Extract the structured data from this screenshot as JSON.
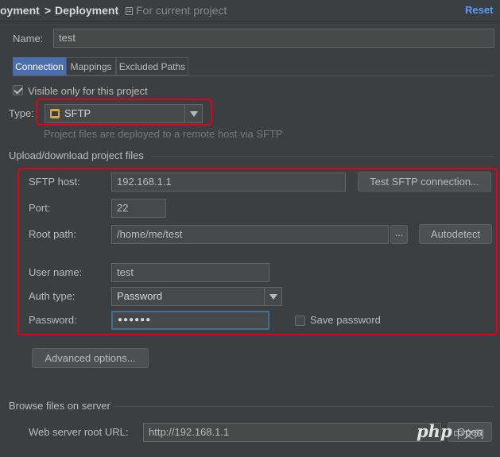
{
  "header": {
    "breadcrumb_first": "oyment",
    "breadcrumb_separator": ">",
    "breadcrumb_second": "Deployment",
    "scope_text": "For current project",
    "reset_label": "Reset"
  },
  "name": {
    "label": "Name:",
    "value": "test"
  },
  "tabs": [
    {
      "label": "Connection",
      "active": true
    },
    {
      "label": "Mappings",
      "active": false
    },
    {
      "label": "Excluded Paths",
      "active": false
    }
  ],
  "visible_only": {
    "label": "Visible only for this project",
    "checked": true
  },
  "type": {
    "label": "Type:",
    "value": "SFTP",
    "description": "Project files are deployed to a remote host via SFTP"
  },
  "upload_section": {
    "title": "Upload/download project files",
    "sftp_host": {
      "label": "SFTP host:",
      "value": "192.168.1.1"
    },
    "test_button": "Test SFTP connection...",
    "port": {
      "label": "Port:",
      "value": "22"
    },
    "root_path": {
      "label": "Root path:",
      "value": "/home/me/test",
      "browse": "..."
    },
    "autodetect_button": "Autodetect",
    "user_name": {
      "label": "User name:",
      "value": "test"
    },
    "auth_type": {
      "label": "Auth type:",
      "value": "Password"
    },
    "password": {
      "label": "Password:",
      "value": "●●●●●●"
    },
    "save_password": {
      "label": "Save password",
      "checked": false
    }
  },
  "advanced_button": "Advanced options...",
  "browse_section": {
    "title": "Browse files on server",
    "web_root": {
      "label": "Web server root URL:",
      "value": "http://192.168.1.1"
    },
    "open_button": "Open"
  },
  "watermark": {
    "text": "php",
    "suffix": "中文网"
  },
  "colors": {
    "accent": "#589df6",
    "highlight_box": "#e3001b",
    "tab_active": "#4b6eaf"
  }
}
